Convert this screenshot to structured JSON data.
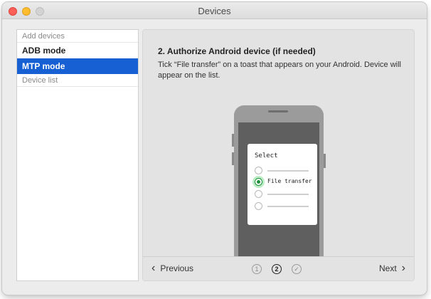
{
  "window": {
    "title": "Devices"
  },
  "sidebar": {
    "sections": [
      {
        "header": "Add devices",
        "items": [
          {
            "label": "ADB mode",
            "selected": false
          },
          {
            "label": "MTP mode",
            "selected": true
          }
        ]
      },
      {
        "header": "Device list",
        "items": []
      }
    ]
  },
  "main": {
    "title": "2. Authorize Android device (if needed)",
    "description": "Tick “File transfer” on a toast that appears on your Android. Device will appear on the list.",
    "illustration": {
      "dialog_title": "Select",
      "selected_option": "File transfer"
    },
    "footer": {
      "previous_label": "Previous",
      "next_label": "Next",
      "steps": [
        "1",
        "2",
        "✓"
      ],
      "current_step": 2
    }
  },
  "colors": {
    "accent": "#1660d4",
    "radio_selected": "#1e8f3a"
  }
}
